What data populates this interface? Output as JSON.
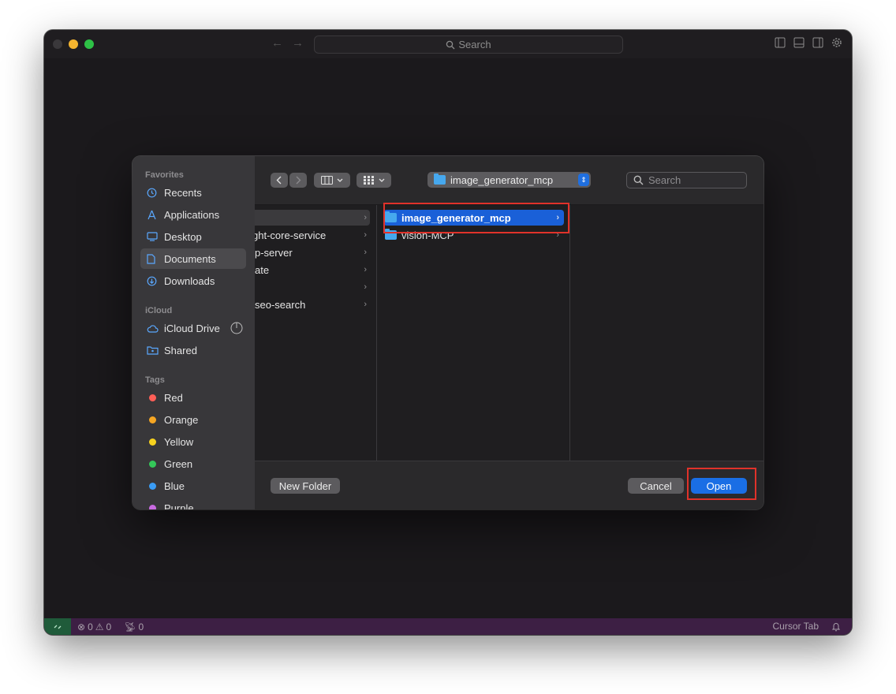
{
  "editor": {
    "command_search": "Search",
    "status_errors": "0",
    "status_warnings": "0",
    "status_ports": "0",
    "status_cursor_tab": "Cursor Tab"
  },
  "sidebar": {
    "favorites_heading": "Favorites",
    "favorites": [
      {
        "label": "Recents",
        "icon": "clock-icon"
      },
      {
        "label": "Applications",
        "icon": "applications-icon"
      },
      {
        "label": "Desktop",
        "icon": "desktop-icon"
      },
      {
        "label": "Documents",
        "icon": "document-icon",
        "selected": true
      },
      {
        "label": "Downloads",
        "icon": "download-icon"
      }
    ],
    "icloud_heading": "iCloud",
    "icloud": [
      {
        "label": "iCloud Drive",
        "icon": "cloud-icon"
      },
      {
        "label": "Shared",
        "icon": "shared-folder-icon"
      }
    ],
    "tags_heading": "Tags",
    "tags": [
      {
        "label": "Red",
        "color": "#ff5f57"
      },
      {
        "label": "Orange",
        "color": "#f5a623"
      },
      {
        "label": "Yellow",
        "color": "#f7d21e"
      },
      {
        "label": "Green",
        "color": "#34c759"
      },
      {
        "label": "Blue",
        "color": "#3a9cf5"
      },
      {
        "label": "Purple",
        "color": "#c86ae0"
      }
    ]
  },
  "toolbar": {
    "path_popup": "image_generator_mcp",
    "search_placeholder": "Search"
  },
  "columns": {
    "col1": [
      "",
      "ght-core-service",
      "p-server",
      "ate",
      "",
      "seo-search"
    ],
    "col2": [
      {
        "label": "image_generator_mcp",
        "selected": true
      },
      {
        "label": "vision-MCP",
        "selected": false
      }
    ]
  },
  "footer": {
    "new_folder": "New Folder",
    "cancel": "Cancel",
    "open": "Open"
  }
}
